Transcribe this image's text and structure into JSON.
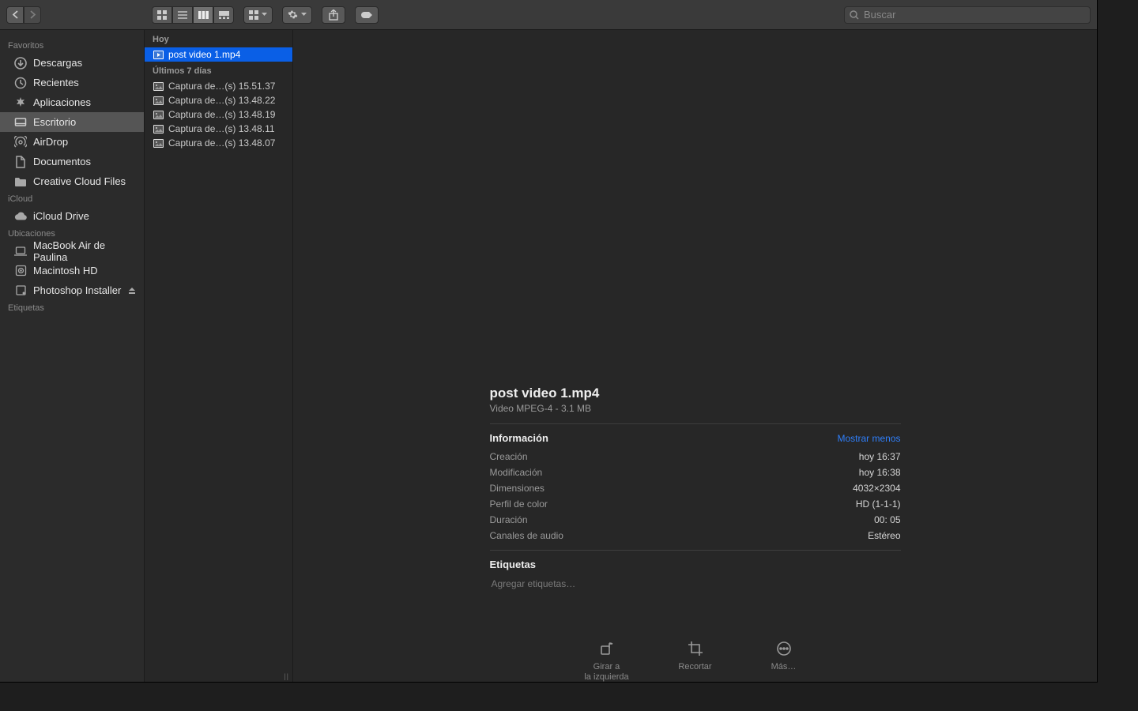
{
  "toolbar": {
    "search_placeholder": "Buscar"
  },
  "sidebar": {
    "sections": [
      {
        "title": "Favoritos",
        "items": [
          {
            "label": "Descargas",
            "icon": "download"
          },
          {
            "label": "Recientes",
            "icon": "clock"
          },
          {
            "label": "Aplicaciones",
            "icon": "apps"
          },
          {
            "label": "Escritorio",
            "icon": "desktop",
            "selected": true
          },
          {
            "label": "AirDrop",
            "icon": "airdrop"
          },
          {
            "label": "Documentos",
            "icon": "document"
          },
          {
            "label": "Creative Cloud Files",
            "icon": "folder"
          }
        ]
      },
      {
        "title": "iCloud",
        "items": [
          {
            "label": "iCloud Drive",
            "icon": "cloud"
          }
        ]
      },
      {
        "title": "Ubicaciones",
        "items": [
          {
            "label": "MacBook Air de Paulina",
            "icon": "laptop"
          },
          {
            "label": "Macintosh HD",
            "icon": "hdd"
          },
          {
            "label": "Photoshop Installer",
            "icon": "disk",
            "eject": true
          }
        ]
      },
      {
        "title": "Etiquetas",
        "items": []
      }
    ]
  },
  "file_list": {
    "groups": [
      {
        "title": "Hoy",
        "files": [
          {
            "name": "post video 1.mp4",
            "icon": "video",
            "selected": true
          }
        ]
      },
      {
        "title": "Últimos 7 días",
        "files": [
          {
            "name": "Captura de…(s) 15.51.37",
            "icon": "image"
          },
          {
            "name": "Captura de…(s) 13.48.22",
            "icon": "image"
          },
          {
            "name": "Captura de…(s) 13.48.19",
            "icon": "image"
          },
          {
            "name": "Captura de…(s) 13.48.11",
            "icon": "image"
          },
          {
            "name": "Captura de…(s) 13.48.07",
            "icon": "image"
          }
        ]
      }
    ]
  },
  "preview": {
    "filename": "post video 1.mp4",
    "subtitle": "Video MPEG-4 - 3.1 MB",
    "info_title": "Información",
    "show_less": "Mostrar menos",
    "rows": [
      {
        "k": "Creación",
        "v": "hoy 16:37"
      },
      {
        "k": "Modificación",
        "v": "hoy 16:38"
      },
      {
        "k": "Dimensiones",
        "v": "4032×2304"
      },
      {
        "k": "Perfil de color",
        "v": "HD (1-1-1)"
      },
      {
        "k": "Duración",
        "v": "00: 05"
      },
      {
        "k": "Canales de audio",
        "v": "Estéreo"
      }
    ],
    "tags_title": "Etiquetas",
    "tags_placeholder": "Agregar etiquetas…",
    "actions": [
      {
        "label": "Girar a\nla izquierda",
        "icon": "rotate"
      },
      {
        "label": "Recortar",
        "icon": "crop"
      },
      {
        "label": "Más…",
        "icon": "more"
      }
    ]
  }
}
